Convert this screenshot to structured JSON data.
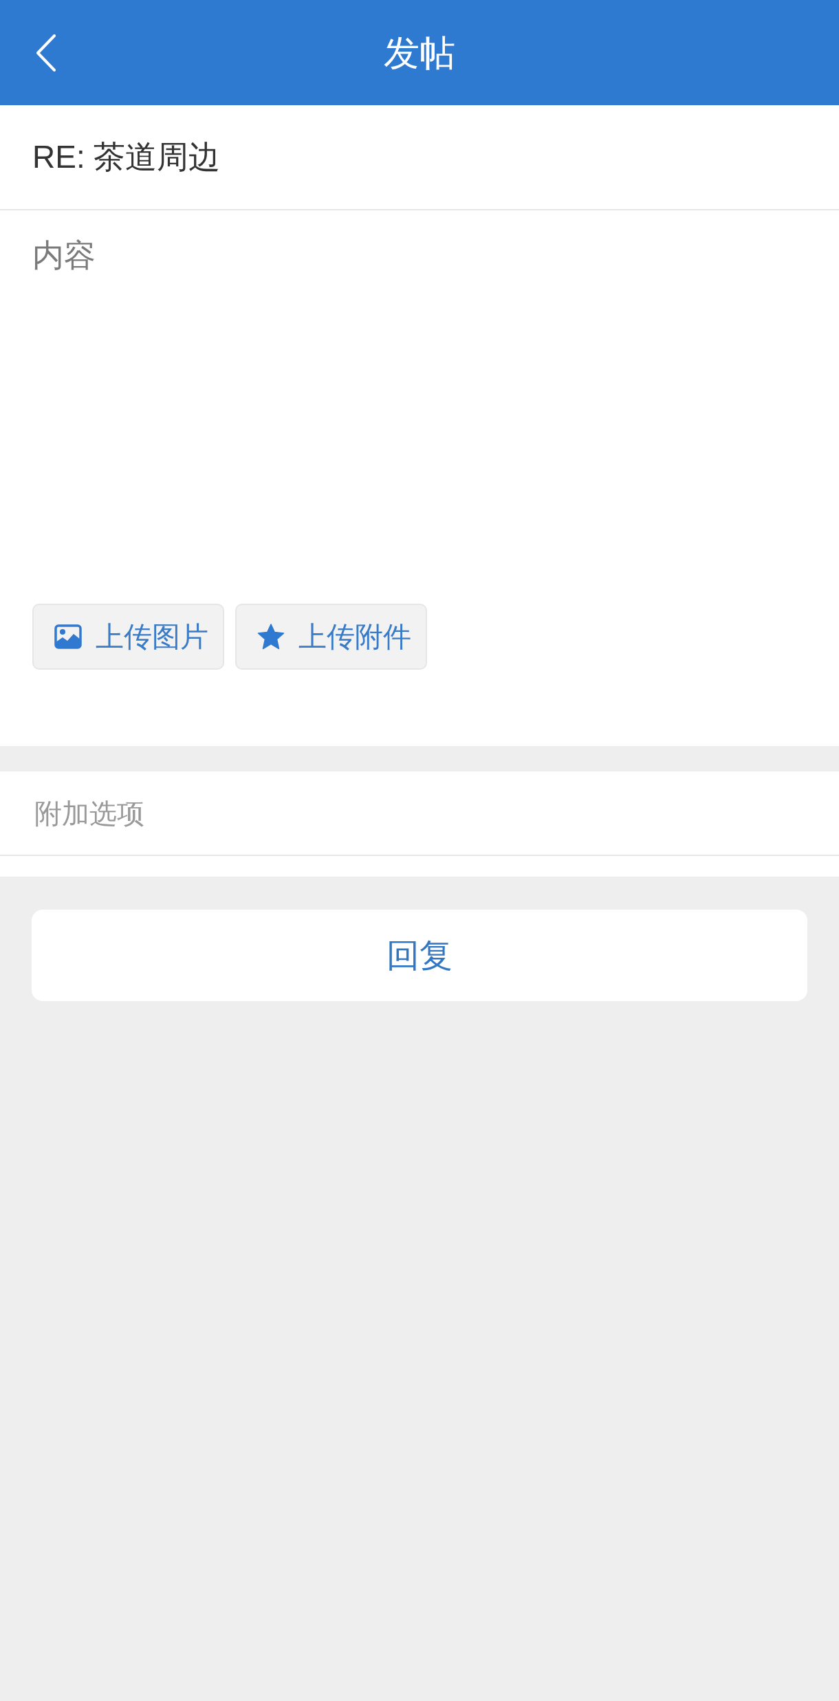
{
  "header": {
    "title": "发帖"
  },
  "subject": {
    "value": "RE: 茶道周边"
  },
  "content": {
    "placeholder": "内容"
  },
  "upload_buttons": [
    {
      "kind": "image",
      "label": "上传图片"
    },
    {
      "kind": "attachment",
      "label": "上传附件"
    }
  ],
  "extra_options": {
    "label": "附加选项"
  },
  "submit_button": {
    "label": "回复"
  }
}
